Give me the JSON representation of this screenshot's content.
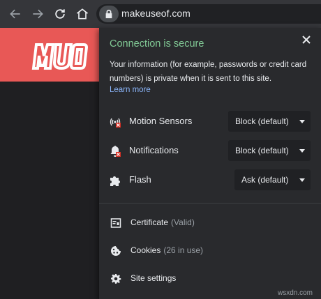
{
  "browser": {
    "url": "makeuseof.com",
    "icons": [
      "back-arrow-icon",
      "forward-arrow-icon",
      "reload-icon",
      "home-icon",
      "lock-icon"
    ]
  },
  "site": {
    "logo_text": "MUO",
    "header_color": "#e85856"
  },
  "popup": {
    "title": "Connection is secure",
    "description": "Your information (for example, passwords or credit card numbers) is private when it is sent to this site.",
    "learn_more": "Learn more",
    "permissions": [
      {
        "label": "Motion Sensors",
        "value": "Block (default)",
        "icon": "motion-sensors-blocked-icon"
      },
      {
        "label": "Notifications",
        "value": "Block (default)",
        "icon": "notifications-blocked-icon"
      },
      {
        "label": "Flash",
        "value": "Ask (default)",
        "icon": "puzzle-icon"
      }
    ],
    "links": [
      {
        "label": "Certificate",
        "sub": "(Valid)",
        "icon": "certificate-icon"
      },
      {
        "label": "Cookies",
        "sub": "(26 in use)",
        "icon": "cookie-icon"
      },
      {
        "label": "Site settings",
        "sub": "",
        "icon": "gear-icon"
      }
    ]
  },
  "colors": {
    "secure_green": "#81c995",
    "link_blue": "#8ab4f8",
    "popup_bg": "#292a2d"
  },
  "watermark": "wsxdn.com"
}
